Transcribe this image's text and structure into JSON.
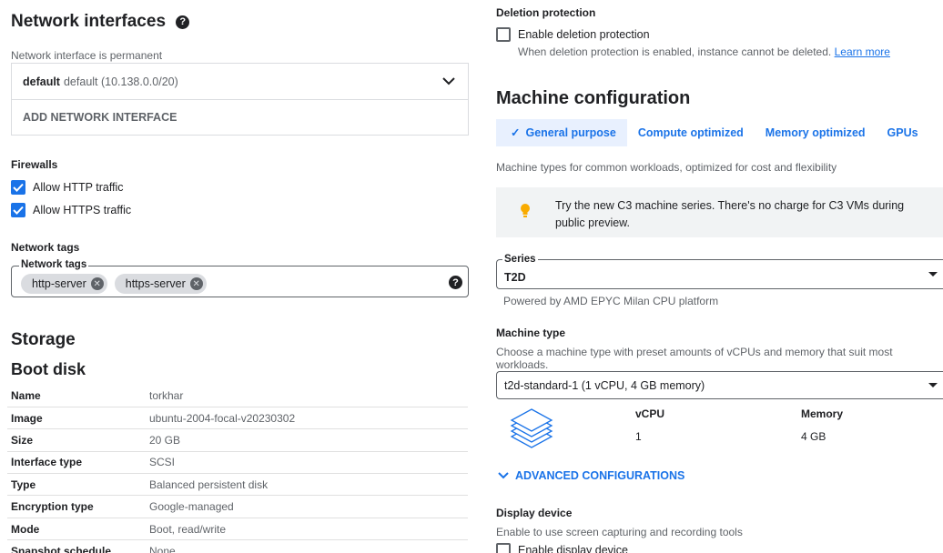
{
  "network": {
    "title": "Network interfaces",
    "permanent_label": "Network interface is permanent",
    "interface_name": "default",
    "interface_detail": "default (10.138.0.0/20)",
    "add_button": "ADD NETWORK INTERFACE"
  },
  "firewalls": {
    "title": "Firewalls",
    "items": [
      {
        "label": "Allow HTTP traffic",
        "checked": true
      },
      {
        "label": "Allow HTTPS traffic",
        "checked": true
      }
    ]
  },
  "network_tags": {
    "title": "Network tags",
    "field_label": "Network tags",
    "tags": [
      "http-server",
      "https-server"
    ]
  },
  "storage": {
    "title": "Storage",
    "boot_disk_title": "Boot disk",
    "rows": [
      {
        "key": "Name",
        "value": "torkhar"
      },
      {
        "key": "Image",
        "value": "ubuntu-2004-focal-v20230302"
      },
      {
        "key": "Size",
        "value": "20 GB"
      },
      {
        "key": "Interface type",
        "value": "SCSI"
      },
      {
        "key": "Type",
        "value": "Balanced persistent disk"
      },
      {
        "key": "Encryption type",
        "value": "Google-managed"
      },
      {
        "key": "Mode",
        "value": "Boot, read/write"
      },
      {
        "key": "Snapshot schedule",
        "value": "None"
      }
    ]
  },
  "deletion": {
    "title": "Deletion protection",
    "checkbox_label": "Enable deletion protection",
    "help": "When deletion protection is enabled, instance cannot be deleted.",
    "learn_more": "Learn more"
  },
  "machine": {
    "title": "Machine configuration",
    "tabs": [
      {
        "label": "General purpose",
        "selected": true
      },
      {
        "label": "Compute optimized",
        "selected": false
      },
      {
        "label": "Memory optimized",
        "selected": false
      },
      {
        "label": "GPUs",
        "selected": false
      }
    ],
    "description": "Machine types for common workloads, optimized for cost and flexibility",
    "banner_line1": "Try the new C3 machine series. There's no charge for C3 VMs during",
    "banner_line2": "public preview.",
    "series_label": "Series",
    "series_value": "T2D",
    "series_help": "Powered by AMD EPYC Milan CPU platform",
    "type_title": "Machine type",
    "type_help": "Choose a machine type with preset amounts of vCPUs and memory that suit most workloads.",
    "type_value": "t2d-standard-1 (1 vCPU, 4 GB memory)",
    "vcpu_header": "vCPU",
    "vcpu_value": "1",
    "memory_header": "Memory",
    "memory_value": "4 GB",
    "advanced": "ADVANCED CONFIGURATIONS"
  },
  "display": {
    "title": "Display device",
    "help": "Enable to use screen capturing and recording tools",
    "checkbox_label": "Enable display device"
  },
  "colors": {
    "accent": "#1a73e8",
    "banner_bg": "#f1f3f4",
    "bulb": "#f9ab00"
  }
}
